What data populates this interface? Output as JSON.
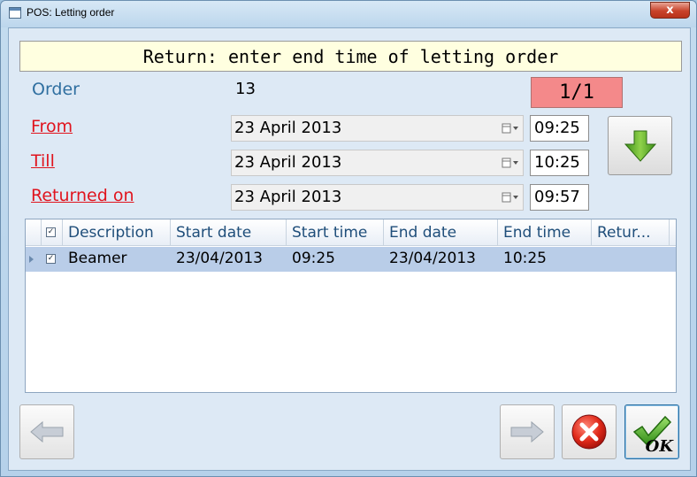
{
  "window": {
    "title": "POS: Letting order",
    "close_glyph": "x"
  },
  "banner": "Return: enter end time of letting order",
  "order": {
    "label": "Order",
    "value": "13",
    "counter": "1/1"
  },
  "fields": {
    "from": {
      "label": "From",
      "date": "23 April 2013",
      "time": "09:25"
    },
    "till": {
      "label": "Till",
      "date": "23 April 2013",
      "time": "10:25"
    },
    "returned_on": {
      "label": "Returned on",
      "date": "23 April 2013",
      "time": "09:57"
    }
  },
  "grid": {
    "columns": [
      "Description",
      "Start date",
      "Start time",
      "End date",
      "End time",
      "Retur..."
    ],
    "header_checked": true,
    "rows": [
      {
        "checked": true,
        "description": "Beamer",
        "start_date": "23/04/2013",
        "start_time": "09:25",
        "end_date": "23/04/2013",
        "end_time": "10:25",
        "returned": ""
      }
    ]
  },
  "buttons": {
    "ok_label": "OK"
  },
  "icons": {
    "calendar": "calendar-dropdown-icon",
    "down": "green-down-arrow-icon",
    "prev": "left-arrow-icon",
    "next": "right-arrow-icon",
    "cancel": "red-x-icon",
    "ok": "green-check-icon"
  },
  "colors": {
    "banner_bg": "#ffffe0",
    "counter_bg": "#f4898a",
    "link_red": "#e0141e",
    "order_label": "#2f6fa0",
    "selected_row": "#b9cde8"
  }
}
